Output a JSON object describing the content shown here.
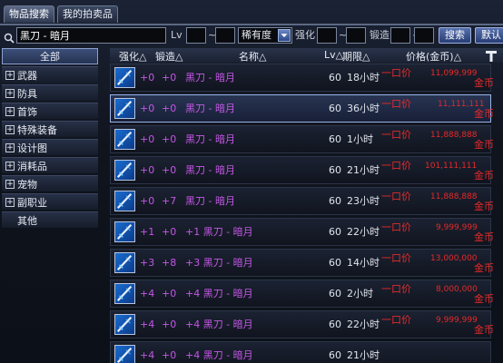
{
  "tabs": [
    {
      "label": "物品搜索"
    },
    {
      "label": "我的拍卖品"
    }
  ],
  "search": {
    "value": "黑刀 - 暗月",
    "lv_label": "Lv",
    "tilde": "~",
    "rarity_value": "稀有度",
    "enhance_label": "强化",
    "forge_label": "锻造",
    "search_button": "搜索",
    "default_button": "默认"
  },
  "categories": [
    {
      "label": "全部",
      "selected": true
    },
    {
      "label": "武器"
    },
    {
      "label": "防具"
    },
    {
      "label": "首饰"
    },
    {
      "label": "特殊装备"
    },
    {
      "label": "设计图"
    },
    {
      "label": "消耗品"
    },
    {
      "label": "宠物"
    },
    {
      "label": "副职业"
    },
    {
      "label": "其他"
    }
  ],
  "columns": {
    "enhance": "强化△",
    "forge": "锻造△",
    "name": "名称△",
    "lv": "Lv△",
    "time": "期限△",
    "price": "价格(金币)△"
  },
  "rows": [
    {
      "up": "+0",
      "forge": "+0",
      "name": "黑刀 - 暗月",
      "lv": "60",
      "time": "18小时",
      "buy": "一口价",
      "price": "11,099,999",
      "cur": "金币"
    },
    {
      "up": "+0",
      "forge": "+0",
      "name": "黑刀 - 暗月",
      "lv": "60",
      "time": "36小时",
      "buy": "一口价",
      "price": "11,111,111",
      "cur": "金币"
    },
    {
      "up": "+0",
      "forge": "+0",
      "name": "黑刀 - 暗月",
      "lv": "60",
      "time": "1小时",
      "buy": "一口价",
      "price": "11,888,888",
      "cur": "金币"
    },
    {
      "up": "+0",
      "forge": "+0",
      "name": "黑刀 - 暗月",
      "lv": "60",
      "time": "21小时",
      "buy": "一口价",
      "price": "101,111,111",
      "cur": "金币"
    },
    {
      "up": "+0",
      "forge": "+7",
      "name": "黑刀 - 暗月",
      "lv": "60",
      "time": "23小时",
      "buy": "一口价",
      "price": "11,888,888",
      "cur": "金币"
    },
    {
      "up": "+1",
      "forge": "+0",
      "name": "+1 黑刀 - 暗月",
      "lv": "60",
      "time": "22小时",
      "buy": "一口价",
      "price": "9,999,999",
      "cur": "金币"
    },
    {
      "up": "+3",
      "forge": "+8",
      "name": "+3 黑刀 - 暗月",
      "lv": "60",
      "time": "14小时",
      "buy": "一口价",
      "price": "13,000,000",
      "cur": "金币"
    },
    {
      "up": "+4",
      "forge": "+0",
      "name": "+4 黑刀 - 暗月",
      "lv": "60",
      "time": "2小时",
      "buy": "一口价",
      "price": "8,000,000",
      "cur": "金币"
    },
    {
      "up": "+4",
      "forge": "+0",
      "name": "+4 黑刀 - 暗月",
      "lv": "60",
      "time": "22小时",
      "buy": "一口价",
      "price": "9,999,999",
      "cur": "金币"
    },
    {
      "up": "+4",
      "forge": "+0",
      "name": "+4 黑刀 - 暗月",
      "lv": "60",
      "time": "21小时",
      "buy": "",
      "price": "",
      "cur": ""
    }
  ]
}
